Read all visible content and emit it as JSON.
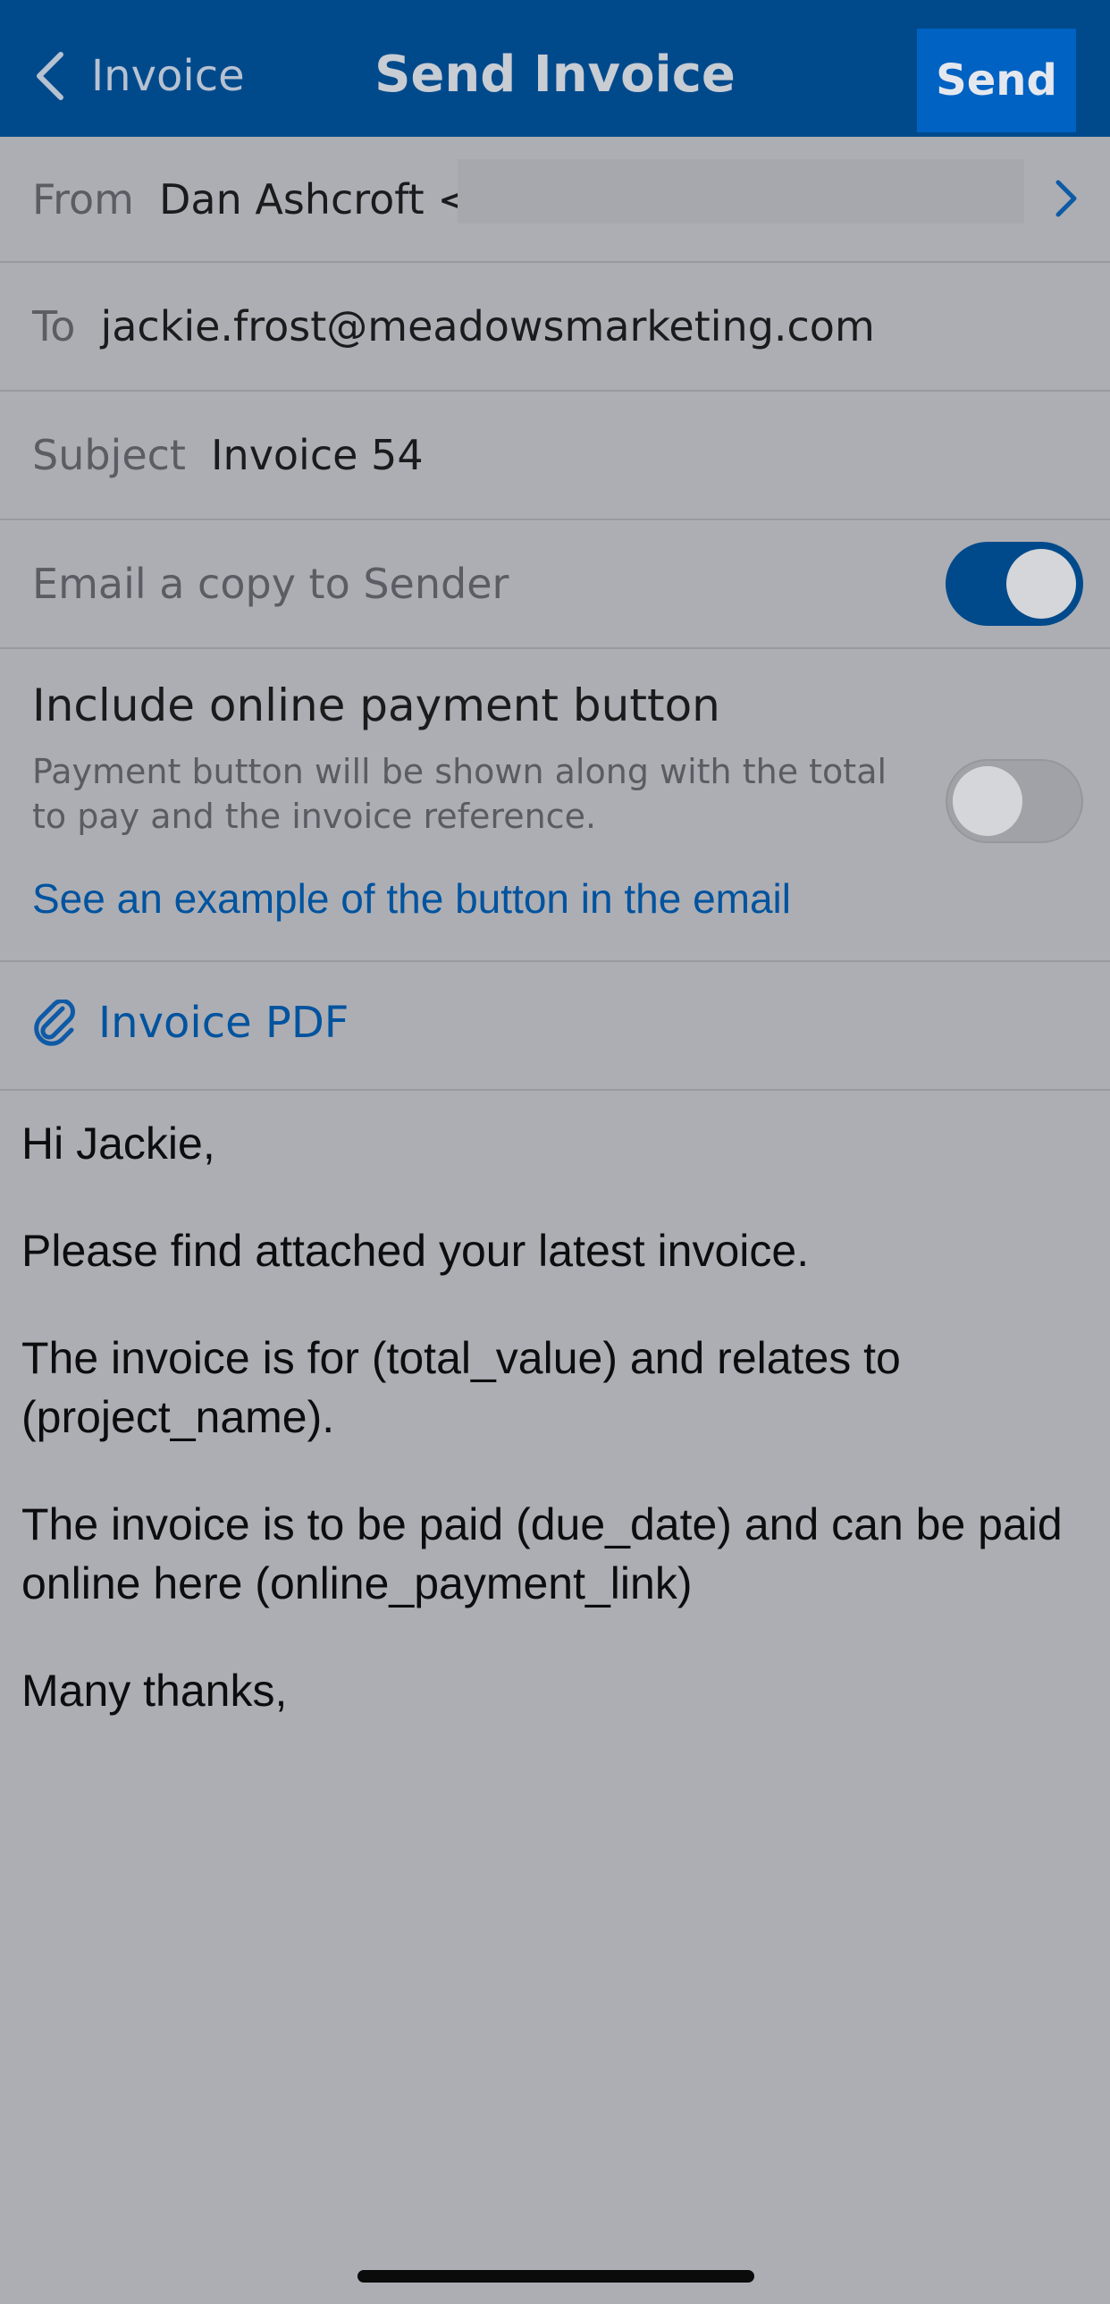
{
  "header": {
    "back_label": "Invoice",
    "title": "Send Invoice",
    "send_label": "Send"
  },
  "fields": {
    "from_label": "From",
    "from_value": "Dan Ashcroft <",
    "to_label": "To",
    "to_value": "jackie.frost@meadowsmarketing.com",
    "subject_label": "Subject",
    "subject_value": "Invoice 54"
  },
  "copy_to_sender": {
    "label": "Email a copy to Sender",
    "enabled": true
  },
  "payment_button": {
    "title": "Include online payment button",
    "description": "Payment button will be shown along with the total to pay and the invoice reference.",
    "enabled": false,
    "example_link": "See an example of the button in the email"
  },
  "attachment": {
    "label": "Invoice PDF",
    "icon": "paperclip-icon"
  },
  "message": {
    "greeting": "Hi Jackie,",
    "line1": "Please find attached your latest invoice.",
    "line2": "The invoice is for (total_value) and relates to (project_name).",
    "line3": "The invoice is to be paid (due_date) and can be paid online here (online_payment_link)",
    "signoff": "Many thanks,"
  },
  "colors": {
    "header_bg": "#004a8c",
    "send_button_bg": "#0062c2",
    "toggle_on": "#004a8c",
    "link": "#00539f",
    "background": "#adaeb3"
  }
}
